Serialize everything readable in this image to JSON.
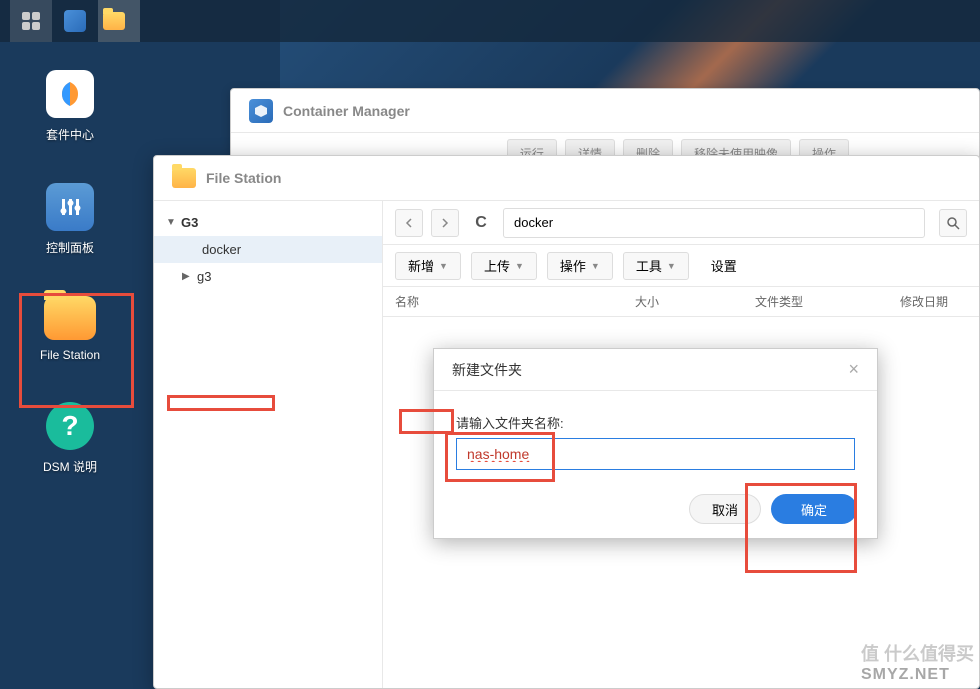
{
  "taskbar": {
    "items": [
      "grid",
      "container",
      "folder"
    ]
  },
  "desktop": {
    "package_center": "套件中心",
    "control_panel": "控制面板",
    "file_station": "File Station",
    "dsm_help": "DSM 说明"
  },
  "container_manager": {
    "title": "Container Manager",
    "toolbar": {
      "run": "运行",
      "details": "详情",
      "delete": "删除",
      "remove_unused": "移除未使用映像",
      "actions": "操作"
    }
  },
  "file_station": {
    "title": "File Station",
    "tree": {
      "root": "G3",
      "docker": "docker",
      "g3": "g3"
    },
    "path": "docker",
    "star_icon": "☆",
    "toolbar": {
      "new": "新增",
      "upload": "上传",
      "operation": "操作",
      "tools": "工具",
      "settings": "设置"
    },
    "columns": {
      "name": "名称",
      "size": "大小",
      "type": "文件类型",
      "modified": "修改日期"
    }
  },
  "modal": {
    "title": "新建文件夹",
    "label": "请输入文件夹名称:",
    "value": "nas-home",
    "cancel": "取消",
    "confirm": "确定"
  },
  "watermark": {
    "top": "值 什么值得买",
    "bottom": "SMYZ.NET"
  }
}
